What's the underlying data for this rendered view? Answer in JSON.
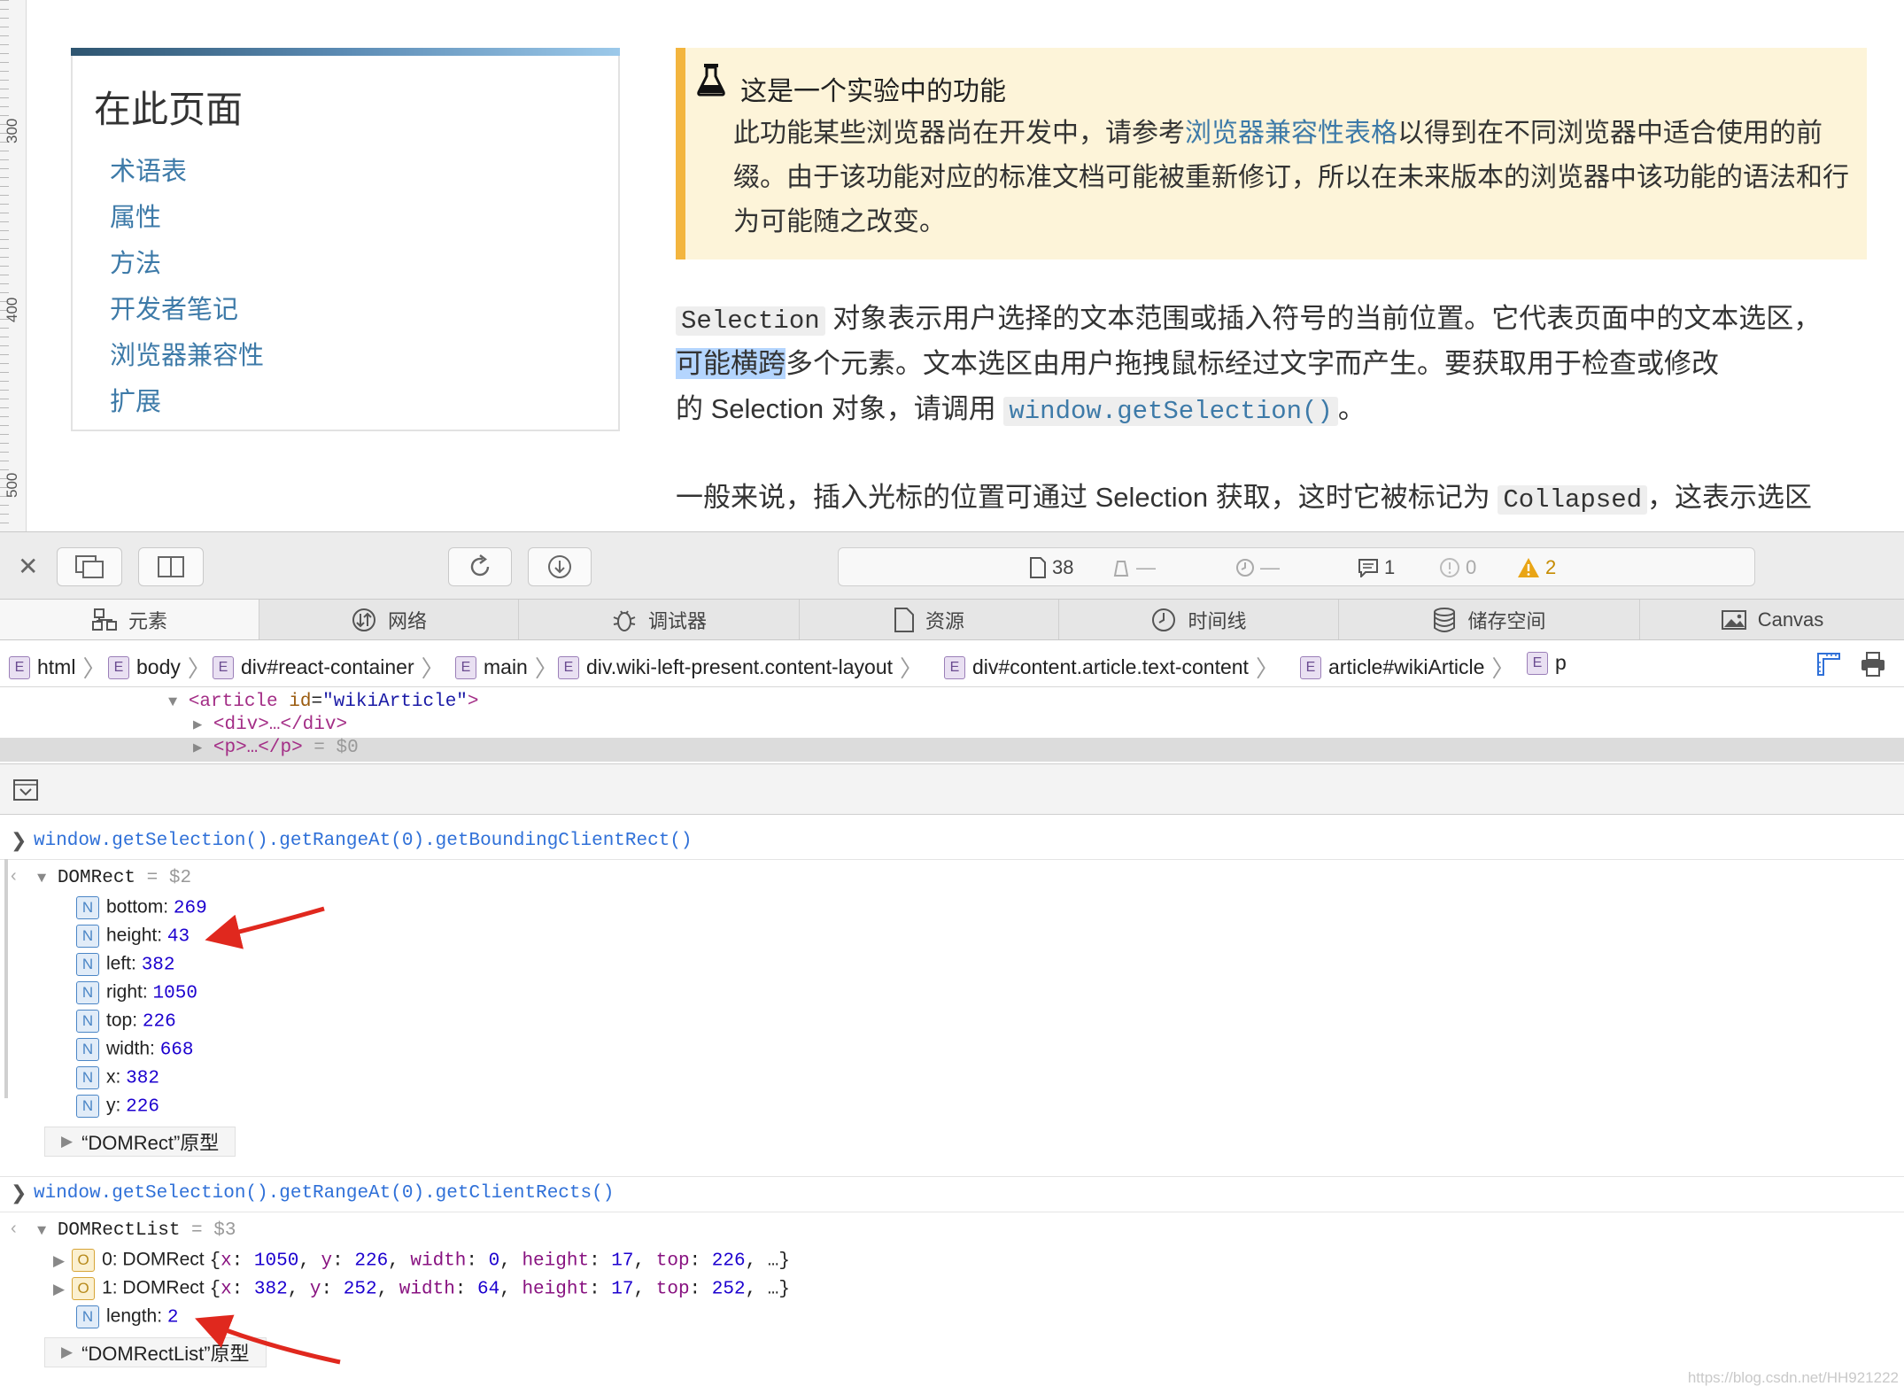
{
  "ruler": {
    "labels": [
      "300",
      "400",
      "500"
    ]
  },
  "toc": {
    "title": "在此页面",
    "links": [
      "术语表",
      "属性",
      "方法",
      "开发者笔记",
      "浏览器兼容性",
      "扩展"
    ]
  },
  "experimental": {
    "title": "这是一个实验中的功能",
    "text_before_link": "此功能某些浏览器尚在开发中，请参考",
    "link": "浏览器兼容性表格",
    "text_after_link": "以得到在不同浏览器中适合使用的前缀。由于该功能对应的标准文档可能被重新修订，所以在未来版本的浏览器中该功能的语法和行为可能随之改变。"
  },
  "article": {
    "p1": {
      "code": "Selection",
      "l1_rest": " 对象表示用户选择的文本范围或插入符号的当前位置。它代表页面中的文本选区，",
      "selected": "可能横跨",
      "l2_rest": "多个元素。文本选区由用户拖拽鼠标经过文字而产生。要获取用于检查或修改",
      "l3_pre": "的 Selection 对象，请调用 ",
      "l3_code": "window.getSelection()",
      "l3_post": "。"
    },
    "p2": {
      "pre": "一般来说，插入光标的位置可通过 Selection 获取，这时它被标记为 ",
      "code": "Collapsed",
      "post": "，这表示选区"
    }
  },
  "toolbar": {
    "resources_count": "38",
    "dash1": "—",
    "dash2": "—",
    "messages": "1",
    "errors": "0",
    "warnings": "2"
  },
  "tabs": [
    "元素",
    "网络",
    "调试器",
    "资源",
    "时间线",
    "储存空间",
    "Canvas"
  ],
  "breadcrumbs": [
    "html",
    "body",
    "div#react-container",
    "main",
    "div.wiki-left-present.content-layout",
    "div#content.article.text-content",
    "article#wikiArticle",
    "p"
  ],
  "badge_letters": {
    "element": "E",
    "number": "N",
    "object": "O"
  },
  "dom": {
    "article_open": "<article",
    "article_attr": "id",
    "article_val": "\"wikiArticle\"",
    "article_close": ">",
    "div_line": "<div>…</div>",
    "p_line": "<p>…</p>",
    "p_ref": " = $0"
  },
  "console": {
    "cmd1": "window.getSelection().getRangeAt(0).getBoundingClientRect()",
    "res1_name": "DOMRect",
    "res1_ref": " = $2",
    "rect_props": [
      {
        "key": "bottom",
        "value": "269"
      },
      {
        "key": "height",
        "value": "43"
      },
      {
        "key": "left",
        "value": "382"
      },
      {
        "key": "right",
        "value": "1050"
      },
      {
        "key": "top",
        "value": "226"
      },
      {
        "key": "width",
        "value": "668"
      },
      {
        "key": "x",
        "value": "382"
      },
      {
        "key": "y",
        "value": "226"
      }
    ],
    "proto1": "“DOMRect”原型",
    "cmd2": "window.getSelection().getRangeAt(0).getClientRects()",
    "res2_name": "DOMRectList",
    "res2_ref": " = $3",
    "list_items": [
      {
        "label": "0: DOMRect",
        "x": "1050",
        "y": "226",
        "width": "0",
        "height": "17",
        "top": "226"
      },
      {
        "label": "1: DOMRect",
        "x": "382",
        "y": "252",
        "width": "64",
        "height": "17",
        "top": "252"
      }
    ],
    "length_key": "length",
    "length_value": "2",
    "proto2": "“DOMRectList”原型"
  },
  "watermark": "https://blog.csdn.net/HH921222"
}
